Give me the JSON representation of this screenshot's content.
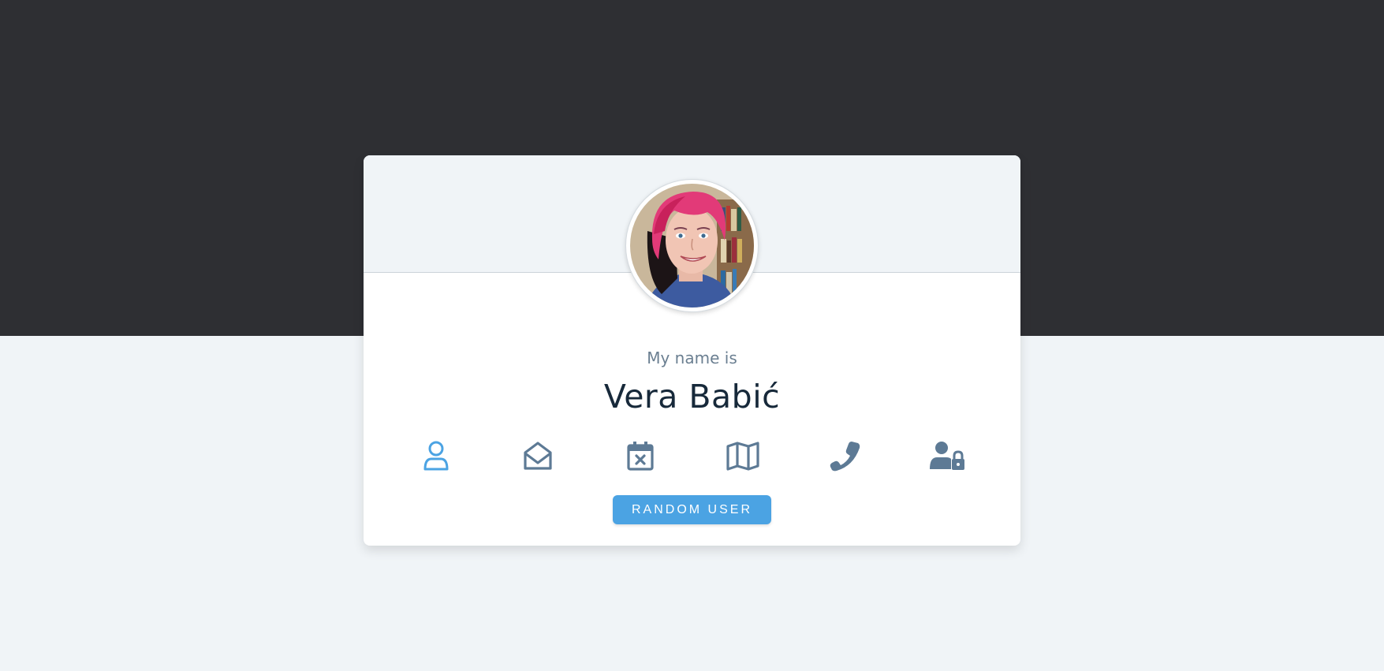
{
  "profile": {
    "label": "My name is",
    "name": "Vera Babić"
  },
  "icons": [
    {
      "name": "user-icon",
      "active": true
    },
    {
      "name": "envelope-open-icon",
      "active": false
    },
    {
      "name": "calendar-x-icon",
      "active": false
    },
    {
      "name": "map-icon",
      "active": false
    },
    {
      "name": "phone-icon",
      "active": false
    },
    {
      "name": "user-lock-icon",
      "active": false
    }
  ],
  "button": {
    "label": "RANDOM USER"
  },
  "colors": {
    "top_band": "#2e2f33",
    "page_bg": "#f0f4f7",
    "accent": "#4ba3e3",
    "icon_default": "#5d7a95",
    "name_text": "#17293a",
    "label_text": "#6b7f91"
  }
}
